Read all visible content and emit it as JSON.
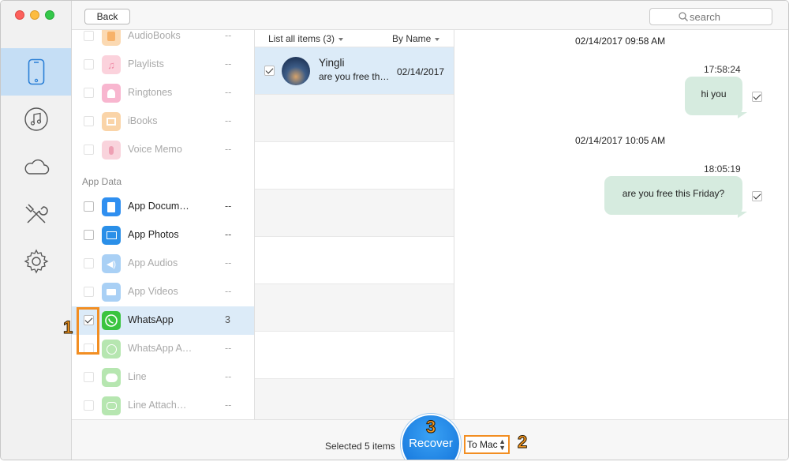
{
  "toolbar": {
    "back_label": "Back",
    "search_placeholder": "search"
  },
  "rail": {
    "items": [
      {
        "name": "device",
        "icon": "phone-icon",
        "active": true
      },
      {
        "name": "itunes",
        "icon": "music-note-icon"
      },
      {
        "name": "icloud",
        "icon": "cloud-icon"
      },
      {
        "name": "tools",
        "icon": "tools-icon"
      },
      {
        "name": "settings",
        "icon": "gear-icon"
      }
    ]
  },
  "categories": {
    "section_app_data": "App Data",
    "items": [
      {
        "label": "AudioBooks",
        "count": "--",
        "icon": "audiobooks-icon",
        "color": "#f7b26a",
        "dim": true,
        "checked": false
      },
      {
        "label": "Playlists",
        "count": "--",
        "icon": "playlists-icon",
        "color": "#f4a0b6",
        "dim": true,
        "checked": false
      },
      {
        "label": "Ringtones",
        "count": "--",
        "icon": "ringtones-icon",
        "color": "#f39abf",
        "dim": true,
        "checked": false
      },
      {
        "label": "iBooks",
        "count": "--",
        "icon": "ibooks-icon",
        "color": "#f6b86a",
        "dim": true,
        "checked": false
      },
      {
        "label": "Voice Memo",
        "count": "--",
        "icon": "voice-memo-icon",
        "color": "#f0a6b8",
        "dim": true,
        "checked": false
      },
      {
        "label": "App Docum…",
        "count": "--",
        "icon": "app-documents-icon",
        "color": "#2f8ff0",
        "dim": false,
        "checked": false
      },
      {
        "label": "App Photos",
        "count": "--",
        "icon": "app-photos-icon",
        "color": "#2a8fe8",
        "dim": false,
        "checked": false
      },
      {
        "label": "App Audios",
        "count": "--",
        "icon": "app-audios-icon",
        "color": "#a9d0f5",
        "dim": true,
        "checked": false
      },
      {
        "label": "App Videos",
        "count": "--",
        "icon": "app-videos-icon",
        "color": "#a9d0f5",
        "dim": true,
        "checked": false
      },
      {
        "label": "WhatsApp",
        "count": "3",
        "icon": "whatsapp-icon",
        "color": "#3ac43f",
        "dim": false,
        "checked": true,
        "selected": true
      },
      {
        "label": "WhatsApp A…",
        "count": "--",
        "icon": "whatsapp-attachments-icon",
        "color": "#b6e6b0",
        "dim": true,
        "checked": false
      },
      {
        "label": "Line",
        "count": "--",
        "icon": "line-icon",
        "color": "#b6e6b0",
        "dim": true,
        "checked": false
      },
      {
        "label": "Line Attach…",
        "count": "--",
        "icon": "line-attachments-icon",
        "color": "#b6e6b0",
        "dim": true,
        "checked": false
      }
    ]
  },
  "message_list": {
    "filter_label": "List all items (3)",
    "sort_label": "By Name",
    "conversations": [
      {
        "name": "Yingli",
        "preview": "are you free th…",
        "date": "02/14/2017",
        "checked": true
      }
    ]
  },
  "chat": {
    "entries": [
      {
        "date": "02/14/2017 09:58 AM",
        "time": "17:58:24",
        "text": "hi you",
        "checked": true
      },
      {
        "date": "02/14/2017 10:05 AM",
        "time": "18:05:19",
        "text": "are you free this Friday?",
        "checked": true
      }
    ]
  },
  "bottom": {
    "selected_text": "Selected 5 items",
    "recover_label": "Recover",
    "destination": "To Mac"
  },
  "annotations": {
    "step1": "1",
    "step2": "2",
    "step3": "3",
    "color": "#f28e22"
  }
}
